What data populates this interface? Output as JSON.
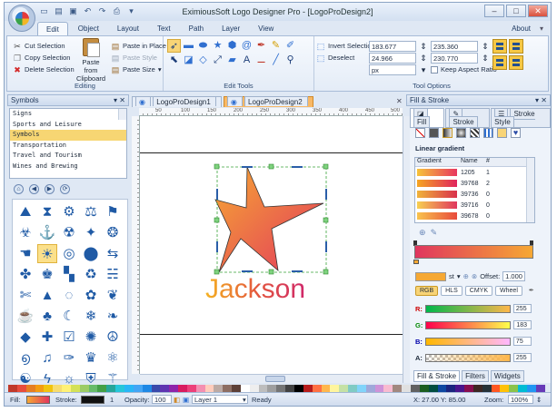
{
  "window": {
    "title": "EximiousSoft Logo Designer Pro - [LogoProDesign2]",
    "buttons": [
      "–",
      "□",
      "✕"
    ]
  },
  "menu": {
    "tabs": [
      "Edit",
      "Object",
      "Layout",
      "Text",
      "Path",
      "Layer",
      "View"
    ],
    "active": "Edit",
    "about": "About"
  },
  "ribbon": {
    "editing": {
      "title": "Editing",
      "cut": "Cut Selection",
      "copy": "Copy Selection",
      "delete": "Delete Selection",
      "paste_clipboard": "Paste from Clipboard",
      "paste_in_place": "Paste in Place",
      "paste_style": "Paste Style",
      "paste_size": "Paste Size"
    },
    "edit_tools": {
      "title": "Edit Tools"
    },
    "tool_options": {
      "title": "Tool Options",
      "invert_selection": "Invert Selection",
      "deselect": "Deselect",
      "x_value": "183.677",
      "y_value": "24.966",
      "w_value": "235.360",
      "h_value": "230.770",
      "unit": "px",
      "keep_aspect": "Keep Aspect Ratio"
    }
  },
  "symbols_panel": {
    "title": "Symbols",
    "categories": [
      "Signs",
      "Sports and Leisure",
      "Symbols",
      "Transportation",
      "Travel and Tourism",
      "Wines and Brewing"
    ],
    "selected": "Symbols"
  },
  "documents": {
    "tabs": [
      "LogoProDesign1",
      "LogoProDesign2"
    ],
    "active": "LogoProDesign2",
    "ruler_labels": [
      "50",
      "100",
      "150",
      "200",
      "250",
      "300",
      "350",
      "400",
      "450",
      "500"
    ]
  },
  "canvas": {
    "text": "Jackson"
  },
  "fill_stroke": {
    "title": "Fill & Stroke",
    "tabs": [
      "Fill",
      "Stroke",
      "Stroke Style"
    ],
    "gradient_label": "Linear gradient",
    "table_headers": [
      "Gradient",
      "Name",
      "#"
    ],
    "rows": [
      {
        "name": "1205",
        "count": "1",
        "from": "#f6c33a",
        "to": "#e8365f"
      },
      {
        "name": "39768",
        "count": "2",
        "from": "#f5a623",
        "to": "#e0245e"
      },
      {
        "name": "39736",
        "count": "0",
        "from": "#f0b33b",
        "to": "#d9304c"
      },
      {
        "name": "39716",
        "count": "0",
        "from": "#f7d051",
        "to": "#e0365e"
      },
      {
        "name": "39678",
        "count": "0",
        "from": "#f9c34d",
        "to": "#e84a3c"
      }
    ],
    "offset_label": "Offset:",
    "offset_value": "1.000",
    "stop_label": "st",
    "modes": [
      "RGB",
      "HLS",
      "CMYK",
      "Wheel"
    ],
    "active_mode": "RGB",
    "channels": [
      {
        "label": "R:",
        "value": "255"
      },
      {
        "label": "G:",
        "value": "183"
      },
      {
        "label": "B:",
        "value": "75"
      },
      {
        "label": "A:",
        "value": "255"
      }
    ],
    "bottom_tabs": [
      "Fill & Stroke",
      "Filters",
      "Widgets"
    ],
    "active_bottom_tab": "Fill & Stroke"
  },
  "palette": [
    "#c0392b",
    "#e74c3c",
    "#e67e22",
    "#f39c12",
    "#f1c40f",
    "#f7dc6f",
    "#fff176",
    "#d4e157",
    "#9ccc65",
    "#66bb6a",
    "#43a047",
    "#26a69a",
    "#26c6da",
    "#29b6f6",
    "#42a5f5",
    "#1e88e5",
    "#3949ab",
    "#5e35b1",
    "#8e24aa",
    "#d81b60",
    "#ec407a",
    "#f48fb1",
    "#ffccbc",
    "#bcaaa4",
    "#8d6e63",
    "#5d4037",
    "#ffffff",
    "#eeeeee",
    "#bdbdbd",
    "#9e9e9e",
    "#757575",
    "#424242",
    "#000000",
    "#b71c1c",
    "#ff7043",
    "#ffb74d",
    "#fff59d",
    "#c5e1a5",
    "#80cbc4",
    "#81d4fa",
    "#9fa8da",
    "#ce93d8",
    "#f8bbd0",
    "#a1887f",
    "#e0e0e0",
    "#616161",
    "#1b5e20",
    "#004d40",
    "#0d47a1",
    "#1a237e",
    "#4a148c",
    "#880e4f",
    "#3e2723",
    "#263238",
    "#ff5722",
    "#ffc107",
    "#8bc34a",
    "#00bcd4",
    "#2196f3",
    "#673ab7"
  ],
  "status": {
    "fill_label": "Fill:",
    "stroke_label": "Stroke:",
    "stroke_width": "1",
    "opacity_label": "Opacity:",
    "opacity_value": "100",
    "layer": "Layer 1",
    "state": "Ready",
    "coords": "X: 27.00 Y: 85.00",
    "zoom_label": "Zoom:",
    "zoom_value": "100%"
  }
}
